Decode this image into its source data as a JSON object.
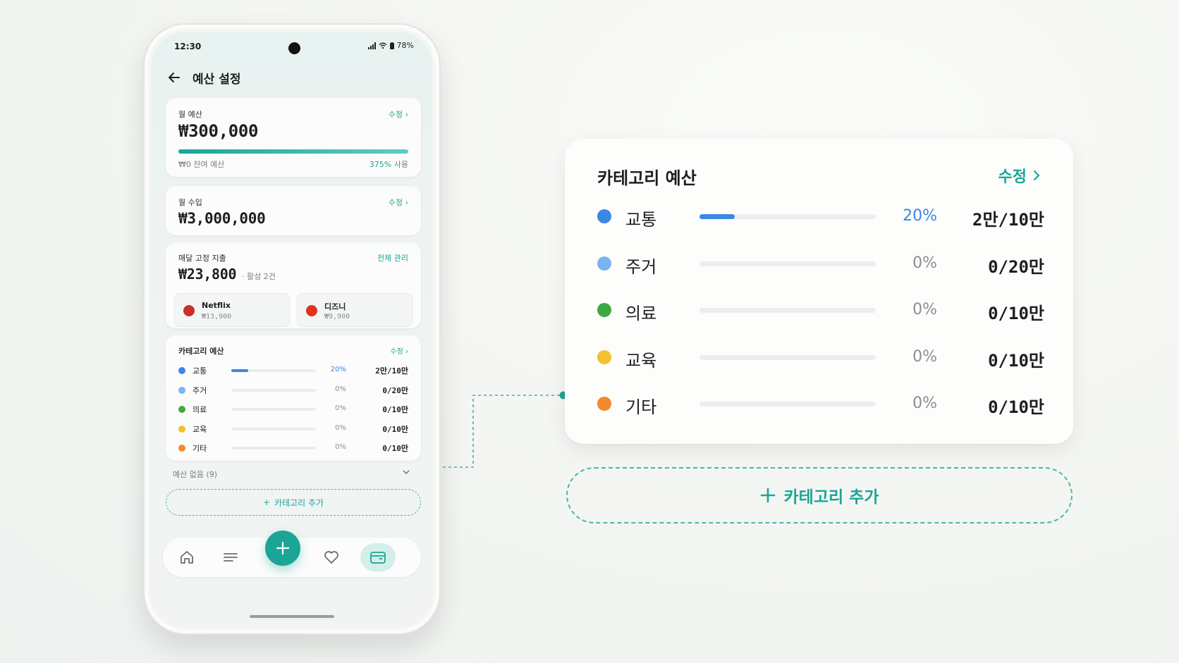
{
  "status": {
    "time": "12:30",
    "battery": "78%"
  },
  "appbar": {
    "title": "예산 설정"
  },
  "monthly_budget": {
    "label": "월 예산",
    "edit": "수정",
    "amount": "₩300,000",
    "remaining": "₩0 잔여 예산",
    "used_pct": "375%",
    "used_suffix": "사용"
  },
  "monthly_income": {
    "label": "월 수입",
    "edit": "수정",
    "amount": "₩3,000,000"
  },
  "fixed_expense": {
    "label": "매달 고정 지출",
    "manage": "전체 관리",
    "amount": "₩23,800",
    "active": "활성 2건",
    "items": [
      {
        "name": "Netflix",
        "price": "₩13,900",
        "color": "#c9302c"
      },
      {
        "name": "디즈니",
        "price": "₩9,900",
        "color": "#e0321f"
      }
    ]
  },
  "category_budget": {
    "title": "카테고리 예산",
    "edit": "수정",
    "items": [
      {
        "name": "교통",
        "pct": "20%",
        "progress": 0.2,
        "amount": "2만/10만",
        "color": "#3a87e6"
      },
      {
        "name": "주거",
        "pct": "0%",
        "progress": 0,
        "amount": "0/20만",
        "color": "#7ab3f0"
      },
      {
        "name": "의료",
        "pct": "0%",
        "progress": 0,
        "amount": "0/10만",
        "color": "#3fa844"
      },
      {
        "name": "교육",
        "pct": "0%",
        "progress": 0,
        "amount": "0/10만",
        "color": "#f2c12e"
      },
      {
        "name": "기타",
        "pct": "0%",
        "progress": 0,
        "amount": "0/10만",
        "color": "#f08a2e"
      }
    ]
  },
  "no_budget": "예산 없음 (9)",
  "add_category": "카테고리 추가",
  "colors": {
    "accent": "#1aa597",
    "primary_blue": "#3a87e6"
  }
}
